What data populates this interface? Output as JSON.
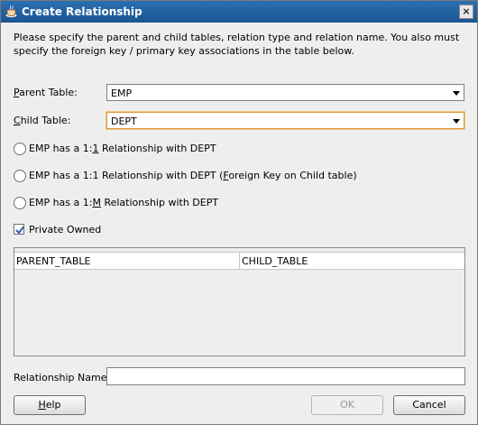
{
  "window": {
    "title": "Create Relationship",
    "close_label": "×"
  },
  "description": "Please specify the parent and child tables, relation type and relation name.  You also must specify the foreign key / primary key associations in the table below.",
  "parent_table": {
    "label_mnemonic": "P",
    "label_rest": "arent Table:",
    "value": "EMP"
  },
  "child_table": {
    "label_mnemonic": "C",
    "label_rest": "hild Table:",
    "value": "DEPT"
  },
  "relationship_options": [
    {
      "pre": "EMP has a 1:",
      "mnemonic": "1",
      "post": " Relationship with DEPT",
      "selected": false
    },
    {
      "pre": "EMP has a 1:1 Relationship with DEPT (",
      "mnemonic": "F",
      "post": "oreign Key on Child table)",
      "selected": false
    },
    {
      "pre": "EMP has a 1:",
      "mnemonic": "M",
      "post": " Relationship with DEPT",
      "selected": false
    }
  ],
  "private_owned": {
    "label": "Private Owned",
    "checked": true
  },
  "association_table": {
    "columns": [
      "PARENT_TABLE",
      "CHILD_TABLE"
    ],
    "rows": []
  },
  "relationship_name": {
    "label": "Relationship Name:",
    "value": ""
  },
  "buttons": {
    "help": {
      "mnemonic": "H",
      "rest": "elp"
    },
    "ok": {
      "label": "OK",
      "enabled": false
    },
    "cancel": {
      "label": "Cancel"
    }
  }
}
